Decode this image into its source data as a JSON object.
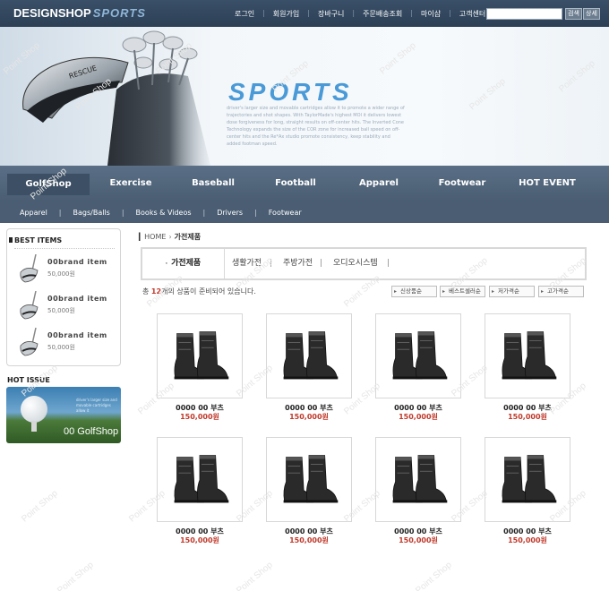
{
  "header": {
    "logo_main": "DESIGNSHOP",
    "logo_sub": "SPORTS",
    "links": [
      "로그인",
      "회원가입",
      "장바구니",
      "주문배송조회",
      "마이샵",
      "고객센터"
    ],
    "search_button": "검색",
    "detail_button": "상세"
  },
  "hero": {
    "title": "SPORTS",
    "description": "driver's larger size and movable cartridges allow it to promote a wider range of trajectories and shot shapes. With TaylorMade's highest MOI it delivers  lowest dose forgiveness for long, straight results on off-center hits. The Inverted Cone Technology expands the size of the COR zone for increased ball speed on off-center hits and the Re*Ax studio promote consistency, keep stability and added footman speed.",
    "club_label": "RESCUE"
  },
  "main_nav": [
    "GolfShop",
    "Exercise",
    "Baseball",
    "Football",
    "Apparel",
    "Footwear",
    "HOT EVENT"
  ],
  "sub_nav": [
    "Apparel",
    "Bags/Balls",
    "Books & Videos",
    "Drivers",
    "Footwear"
  ],
  "sidebar": {
    "best_title": "BEST ITEMS",
    "best_items": [
      {
        "name": "00brand item",
        "price": "50,000원"
      },
      {
        "name": "00brand item",
        "price": "50,000원"
      },
      {
        "name": "00brand item",
        "price": "50,000원"
      }
    ],
    "hot_title": "HOT ISSUE",
    "hot_tagline": "driver's larger size and movable cartridges allow it",
    "hot_name": "00 GolfShop"
  },
  "content": {
    "breadcrumb_home": "HOME",
    "breadcrumb_current": "가전제품",
    "categories": [
      "가전제품",
      "생활가전",
      "주방가전",
      "오디오시스템"
    ],
    "count_prefix": "총",
    "count_value": "12",
    "count_suffix": "개의 상품이 준비되어 있습니다.",
    "sort_buttons": [
      "신상품순",
      "베스트셀러순",
      "저가격순",
      "고가격순"
    ],
    "products": [
      {
        "name": "0000 00 부츠",
        "price": "150,000원"
      },
      {
        "name": "0000 00 부츠",
        "price": "150,000원"
      },
      {
        "name": "0000 00 부츠",
        "price": "150,000원"
      },
      {
        "name": "0000 00 부츠",
        "price": "150,000원"
      },
      {
        "name": "0000 00 부츠",
        "price": "150,000원"
      },
      {
        "name": "0000 00 부츠",
        "price": "150,000원"
      },
      {
        "name": "0000 00 부츠",
        "price": "150,000원"
      },
      {
        "name": "0000 00 부츠",
        "price": "150,000원"
      }
    ]
  },
  "watermark": "Point Shop",
  "colors": {
    "header_bg": "#2c3f55",
    "nav_bg": "#4a5d72",
    "accent_red": "#c0392b",
    "hero_title": "#4a9ad8"
  }
}
